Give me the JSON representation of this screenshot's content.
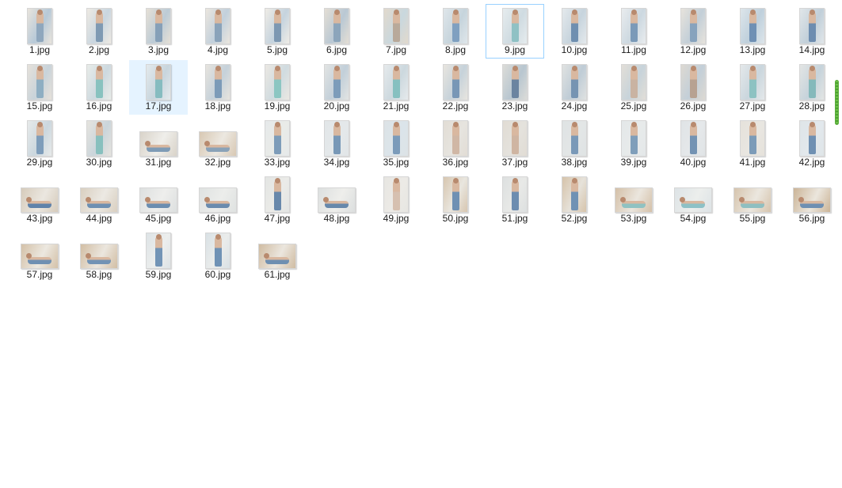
{
  "files": {
    "selected": "17.jpg",
    "focused": "9.jpg",
    "items": [
      {
        "name": "1.jpg",
        "orientation": "portrait",
        "palette": [
          "#e9e4dc",
          "#8fa7bd",
          "#b7c9d8"
        ]
      },
      {
        "name": "2.jpg",
        "orientation": "portrait",
        "palette": [
          "#eeeae3",
          "#7f9ab3",
          "#c9d6e0"
        ]
      },
      {
        "name": "3.jpg",
        "orientation": "portrait",
        "palette": [
          "#e6e0d6",
          "#86a0b8",
          "#bccbd6"
        ]
      },
      {
        "name": "4.jpg",
        "orientation": "portrait",
        "palette": [
          "#ebe6de",
          "#8aa3ba",
          "#c2d0dc"
        ]
      },
      {
        "name": "5.jpg",
        "orientation": "portrait",
        "palette": [
          "#efece6",
          "#7d98b2",
          "#c5d3de"
        ]
      },
      {
        "name": "6.jpg",
        "orientation": "portrait",
        "palette": [
          "#e4ded4",
          "#8ca5bb",
          "#b9c8d4"
        ]
      },
      {
        "name": "7.jpg",
        "orientation": "portrait",
        "palette": [
          "#e2d9cc",
          "#b8a99a",
          "#c9d8de"
        ]
      },
      {
        "name": "8.jpg",
        "orientation": "portrait",
        "palette": [
          "#dfe6ea",
          "#7fa0c0",
          "#c6d4dc"
        ]
      },
      {
        "name": "9.jpg",
        "orientation": "portrait",
        "palette": [
          "#e6ecee",
          "#8fc1c4",
          "#cfdbe1"
        ]
      },
      {
        "name": "10.jpg",
        "orientation": "portrait",
        "palette": [
          "#e4e9ec",
          "#6f8fb0",
          "#c7d4dd"
        ]
      },
      {
        "name": "11.jpg",
        "orientation": "portrait",
        "palette": [
          "#e9ecee",
          "#7b9ab8",
          "#ccd8e0"
        ]
      },
      {
        "name": "12.jpg",
        "orientation": "portrait",
        "palette": [
          "#e7e3dc",
          "#87a3bd",
          "#c3cfd8"
        ]
      },
      {
        "name": "13.jpg",
        "orientation": "portrait",
        "palette": [
          "#dde5ea",
          "#6f90b4",
          "#bfd0dc"
        ]
      },
      {
        "name": "14.jpg",
        "orientation": "portrait",
        "palette": [
          "#e1e6e9",
          "#6d8db0",
          "#c1cfd9"
        ]
      },
      {
        "name": "15.jpg",
        "orientation": "portrait",
        "palette": [
          "#e6e1da",
          "#8eaec2",
          "#c8d3da"
        ]
      },
      {
        "name": "16.jpg",
        "orientation": "portrait",
        "palette": [
          "#e8ece9",
          "#88c2bf",
          "#cdd9df"
        ]
      },
      {
        "name": "17.jpg",
        "orientation": "portrait",
        "palette": [
          "#e3e9ec",
          "#86bcc0",
          "#c8d5dd"
        ]
      },
      {
        "name": "18.jpg",
        "orientation": "portrait",
        "palette": [
          "#e7e4de",
          "#7c9bb8",
          "#c5d1da"
        ]
      },
      {
        "name": "19.jpg",
        "orientation": "portrait",
        "palette": [
          "#ebe8e2",
          "#8cc6c2",
          "#d0dbe0"
        ]
      },
      {
        "name": "20.jpg",
        "orientation": "portrait",
        "palette": [
          "#e2e4e3",
          "#7c9cba",
          "#c2cfd9"
        ]
      },
      {
        "name": "21.jpg",
        "orientation": "portrait",
        "palette": [
          "#e6eaec",
          "#86c0c0",
          "#ccd8de"
        ]
      },
      {
        "name": "22.jpg",
        "orientation": "portrait",
        "palette": [
          "#e8e5df",
          "#7897b6",
          "#c6d2da"
        ]
      },
      {
        "name": "23.jpg",
        "orientation": "portrait",
        "palette": [
          "#dcdcd8",
          "#6b84a0",
          "#b8c6d0"
        ]
      },
      {
        "name": "24.jpg",
        "orientation": "portrait",
        "palette": [
          "#e0e2e1",
          "#7694b2",
          "#bfccd6"
        ]
      },
      {
        "name": "25.jpg",
        "orientation": "portrait",
        "palette": [
          "#e2ded7",
          "#c9b3a2",
          "#c7d3da"
        ]
      },
      {
        "name": "26.jpg",
        "orientation": "portrait",
        "palette": [
          "#ddd9d2",
          "#b7a292",
          "#c3cfd8"
        ]
      },
      {
        "name": "27.jpg",
        "orientation": "portrait",
        "palette": [
          "#e4e8ea",
          "#8dc2c2",
          "#cad6dd"
        ]
      },
      {
        "name": "28.jpg",
        "orientation": "portrait",
        "palette": [
          "#e3e5e4",
          "#84b9bb",
          "#c6d3db"
        ]
      },
      {
        "name": "29.jpg",
        "orientation": "portrait",
        "palette": [
          "#e7eaea",
          "#7e9dba",
          "#cbd7de"
        ]
      },
      {
        "name": "30.jpg",
        "orientation": "portrait",
        "palette": [
          "#e6e4df",
          "#88c0be",
          "#cad5db"
        ]
      },
      {
        "name": "31.jpg",
        "orientation": "landscape",
        "palette": [
          "#d9d3c9",
          "#7e9bb6",
          "#efeeea"
        ]
      },
      {
        "name": "32.jpg",
        "orientation": "landscape",
        "palette": [
          "#d8c8b3",
          "#8aa2b8",
          "#ece8e1"
        ]
      },
      {
        "name": "33.jpg",
        "orientation": "portrait",
        "palette": [
          "#e6e9ea",
          "#7d9cb9",
          "#e9ebe8"
        ]
      },
      {
        "name": "34.jpg",
        "orientation": "portrait",
        "palette": [
          "#e2e6e8",
          "#7898b7",
          "#e4e8ea"
        ]
      },
      {
        "name": "35.jpg",
        "orientation": "portrait",
        "palette": [
          "#dde3e6",
          "#7b9bba",
          "#dbe4ea"
        ]
      },
      {
        "name": "36.jpg",
        "orientation": "portrait",
        "palette": [
          "#e2ddd5",
          "#d0b7a5",
          "#e6e4df"
        ]
      },
      {
        "name": "37.jpg",
        "orientation": "portrait",
        "palette": [
          "#e1dcd4",
          "#cfb5a2",
          "#e4e2dd"
        ]
      },
      {
        "name": "38.jpg",
        "orientation": "portrait",
        "palette": [
          "#dfe3e4",
          "#7a99b8",
          "#e3e6e6"
        ]
      },
      {
        "name": "39.jpg",
        "orientation": "portrait",
        "palette": [
          "#e4e8e9",
          "#7f9eba",
          "#e7eaea"
        ]
      },
      {
        "name": "40.jpg",
        "orientation": "portrait",
        "palette": [
          "#e0e4e6",
          "#7493b3",
          "#e5e8ea"
        ]
      },
      {
        "name": "41.jpg",
        "orientation": "portrait",
        "palette": [
          "#e6e2db",
          "#7c9bb8",
          "#e8e6e1"
        ]
      },
      {
        "name": "42.jpg",
        "orientation": "portrait",
        "palette": [
          "#dfe5e8",
          "#6f90b2",
          "#e2e8ec"
        ]
      },
      {
        "name": "43.jpg",
        "orientation": "landscape",
        "palette": [
          "#d6cbbb",
          "#5f82aa",
          "#ebe7e0"
        ]
      },
      {
        "name": "44.jpg",
        "orientation": "landscape",
        "palette": [
          "#d9cfc0",
          "#6d8fb2",
          "#ece9e3"
        ]
      },
      {
        "name": "45.jpg",
        "orientation": "landscape",
        "palette": [
          "#dde0e0",
          "#6b8db0",
          "#eeeeec"
        ]
      },
      {
        "name": "46.jpg",
        "orientation": "landscape",
        "palette": [
          "#dfe2e1",
          "#6a8bae",
          "#ecedeb"
        ]
      },
      {
        "name": "47.jpg",
        "orientation": "portrait",
        "palette": [
          "#e3e5e3",
          "#6888ab",
          "#ebebe8"
        ]
      },
      {
        "name": "48.jpg",
        "orientation": "landscape",
        "palette": [
          "#dcdfdf",
          "#6788ab",
          "#eeeeeb"
        ]
      },
      {
        "name": "49.jpg",
        "orientation": "portrait",
        "palette": [
          "#e7e6e2",
          "#d6c0b0",
          "#eceae6"
        ]
      },
      {
        "name": "50.jpg",
        "orientation": "portrait",
        "palette": [
          "#d7c6b0",
          "#6f90b3",
          "#e9e6df"
        ]
      },
      {
        "name": "51.jpg",
        "orientation": "portrait",
        "palette": [
          "#dde0e0",
          "#6d8db0",
          "#e8e9e7"
        ]
      },
      {
        "name": "52.jpg",
        "orientation": "portrait",
        "palette": [
          "#d6c3aa",
          "#7092b4",
          "#e6e2da"
        ]
      },
      {
        "name": "53.jpg",
        "orientation": "landscape",
        "palette": [
          "#d4c0a8",
          "#8fc2c2",
          "#ebe6de"
        ]
      },
      {
        "name": "54.jpg",
        "orientation": "landscape",
        "palette": [
          "#dde3e6",
          "#8dc1c6",
          "#eceeec"
        ]
      },
      {
        "name": "55.jpg",
        "orientation": "landscape",
        "palette": [
          "#d6c4ad",
          "#8ebfc1",
          "#ebe7df"
        ]
      },
      {
        "name": "56.jpg",
        "orientation": "landscape",
        "palette": [
          "#cbb497",
          "#6e8fb2",
          "#ebe6dd"
        ]
      },
      {
        "name": "57.jpg",
        "orientation": "landscape",
        "palette": [
          "#d4c1a8",
          "#6f90b2",
          "#ece8e0"
        ]
      },
      {
        "name": "58.jpg",
        "orientation": "landscape",
        "palette": [
          "#d2bea4",
          "#7293b5",
          "#ebe6de"
        ]
      },
      {
        "name": "59.jpg",
        "orientation": "portrait",
        "palette": [
          "#dde3e6",
          "#7294b6",
          "#eceeed"
        ]
      },
      {
        "name": "60.jpg",
        "orientation": "portrait",
        "palette": [
          "#d9e1e5",
          "#6f92b5",
          "#eaeceb"
        ]
      },
      {
        "name": "61.jpg",
        "orientation": "landscape",
        "palette": [
          "#d0bca2",
          "#6e8fb1",
          "#ebe6de"
        ]
      }
    ]
  },
  "scrollbar": {
    "thumb_color": "#5aad3c"
  }
}
